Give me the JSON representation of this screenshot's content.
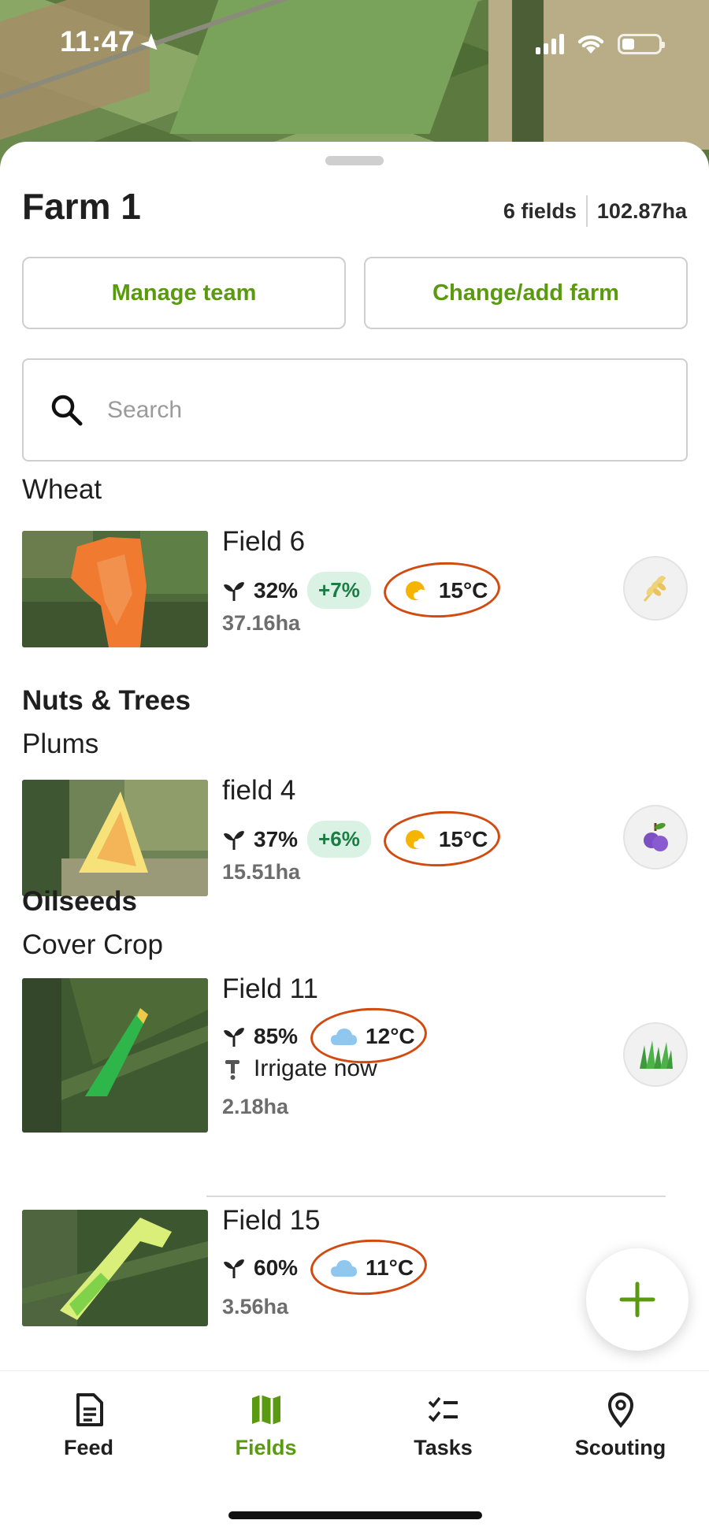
{
  "status_bar": {
    "time": "11:47",
    "icons": [
      "location-arrow-icon",
      "signal-icon",
      "wifi-icon",
      "battery-icon"
    ],
    "battery_level": 0.35
  },
  "farm": {
    "title": "Farm 1",
    "fields_count": "6 fields",
    "total_area": "102.87ha"
  },
  "buttons": {
    "manage_team": "Manage team",
    "change_farm": "Change/add farm"
  },
  "search": {
    "placeholder": "Search",
    "value": ""
  },
  "groups": {
    "wheat": "Wheat",
    "nuts_trees": "Nuts & Trees",
    "plums": "Plums",
    "oilseeds": "Oilseeds",
    "cover_crop": "Cover Crop"
  },
  "fields": [
    {
      "name": "Field 6",
      "vegetation": "32%",
      "delta": "+7%",
      "weather": "15°C",
      "weather_icon": "sun-cloud-icon",
      "area": "37.16ha",
      "crop_icon": "wheat-icon"
    },
    {
      "name": "field 4",
      "vegetation": "37%",
      "delta": "+6%",
      "weather": "15°C",
      "weather_icon": "sun-cloud-icon",
      "area": "15.51ha",
      "crop_icon": "plum-icon"
    },
    {
      "name": "Field 11",
      "vegetation": "85%",
      "weather": "12°C",
      "weather_icon": "cloud-icon",
      "action": "Irrigate now",
      "area": "2.18ha",
      "crop_icon": "grass-icon"
    },
    {
      "name": "Field 15",
      "vegetation": "60%",
      "weather": "11°C",
      "weather_icon": "cloud-icon",
      "area": "3.56ha",
      "crop_icon": "grass-icon"
    }
  ],
  "nav": {
    "feed": "Feed",
    "fields": "Fields",
    "tasks": "Tasks",
    "scouting": "Scouting",
    "active": "fields"
  },
  "colors": {
    "accent": "#5a9a10",
    "annotation_ring": "#d24a10",
    "delta_bg": "#d9f2e3",
    "delta_text": "#1c7d44"
  }
}
